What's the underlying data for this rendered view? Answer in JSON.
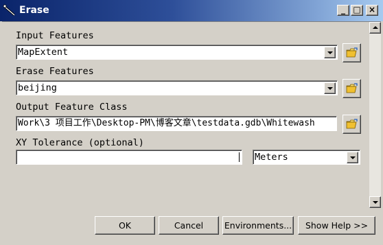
{
  "window": {
    "title": "Erase",
    "minimize": "_",
    "maximize": "□",
    "close": "×"
  },
  "form": {
    "input_features": {
      "label": "Input Features",
      "value": "MapExtent"
    },
    "erase_features": {
      "label": "Erase Features",
      "value": "beijing"
    },
    "output_feature_class": {
      "label": "Output Feature Class",
      "value": "Work\\3 项目工作\\Desktop-PM\\博客文章\\testdata.gdb\\Whitewash"
    },
    "xy_tolerance": {
      "label": "XY Tolerance (optional)",
      "value": "",
      "unit": "Meters"
    }
  },
  "buttons": {
    "ok": "OK",
    "cancel": "Cancel",
    "environments": "Environments...",
    "show_help": "Show Help >>"
  },
  "icons": {
    "title": "erase-tool-icon",
    "browse": "open-folder-icon"
  }
}
